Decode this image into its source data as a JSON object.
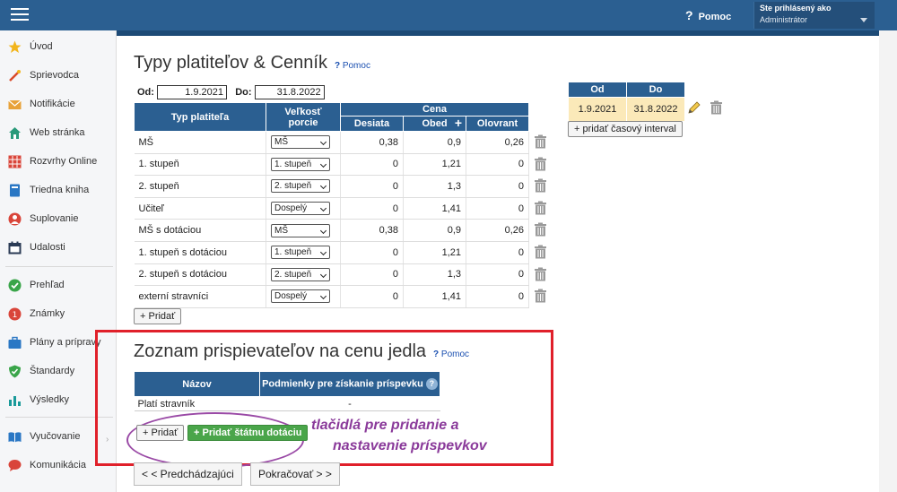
{
  "topbar": {
    "help_label": "Pomoc",
    "user_label": "Ste prihlásený ako",
    "user_value": "Administrátor"
  },
  "sidebar": {
    "items": [
      {
        "label": "Úvod",
        "icon": "star-icon",
        "color": "#f2b51c"
      },
      {
        "label": "Sprievodca",
        "icon": "wand-icon",
        "color": "#d94b2b"
      },
      {
        "label": "Notifikácie",
        "icon": "envelope-icon",
        "color": "#e8a23a"
      },
      {
        "label": "Web stránka",
        "icon": "home-icon",
        "color": "#2a9a7a"
      },
      {
        "label": "Rozvrhy Online",
        "icon": "calendar-grid-icon",
        "color": "#d9453a"
      },
      {
        "label": "Triedna kniha",
        "icon": "book-icon",
        "color": "#2a77c4"
      },
      {
        "label": "Suplovanie",
        "icon": "person-icon",
        "color": "#d9453a"
      },
      {
        "label": "Udalosti",
        "icon": "calendar-icon",
        "color": "#2b3b55"
      },
      {
        "label": "Prehľad",
        "icon": "check-circle-icon",
        "color": "#3aa54a"
      },
      {
        "label": "Známky",
        "icon": "grade-icon",
        "color": "#d9453a"
      },
      {
        "label": "Plány a prípravy",
        "icon": "briefcase-icon",
        "color": "#2a77c4"
      },
      {
        "label": "Štandardy",
        "icon": "shield-check-icon",
        "color": "#3aa54a"
      },
      {
        "label": "Výsledky",
        "icon": "bar-chart-icon",
        "color": "#1a9a9a"
      },
      {
        "label": "Vyučovanie",
        "icon": "open-book-icon",
        "color": "#2a77c4"
      },
      {
        "label": "Komunikácia",
        "icon": "chat-icon",
        "color": "#d9453a"
      }
    ]
  },
  "main": {
    "title": "Typy platiteľov & Cenník",
    "help_label": "Pomoc",
    "date_from_label": "Od:",
    "date_from": "1.9.2021",
    "date_to_label": "Do:",
    "date_to": "31.8.2022",
    "table": {
      "col_type": "Typ platiteľa",
      "col_size": "Veľkosť porcie",
      "col_price": "Cena",
      "col_snack1": "Desiata",
      "col_lunch": "Obed",
      "col_snack2": "Olovrant",
      "rows": [
        {
          "type": "MŠ",
          "size": "MŠ",
          "desiata": "0,38",
          "obed": "0,9",
          "olovrant": "0,26"
        },
        {
          "type": "1. stupeň",
          "size": "1. stupeň",
          "desiata": "0",
          "obed": "1,21",
          "olovrant": "0"
        },
        {
          "type": "2. stupeň",
          "size": "2. stupeň",
          "desiata": "0",
          "obed": "1,3",
          "olovrant": "0"
        },
        {
          "type": "Učiteľ",
          "size": "Dospelý",
          "desiata": "0",
          "obed": "1,41",
          "olovrant": "0"
        },
        {
          "type": "MŠ s dotáciou",
          "size": "MŠ",
          "desiata": "0,38",
          "obed": "0,9",
          "olovrant": "0,26"
        },
        {
          "type": "1. stupeň s dotáciou",
          "size": "1. stupeň",
          "desiata": "0",
          "obed": "1,21",
          "olovrant": "0"
        },
        {
          "type": "2. stupeň s dotáciou",
          "size": "2. stupeň",
          "desiata": "0",
          "obed": "1,3",
          "olovrant": "0"
        },
        {
          "type": "externí stravníci",
          "size": "Dospelý",
          "desiata": "0",
          "obed": "1,41",
          "olovrant": "0"
        }
      ]
    },
    "add_label": "+ Pridať",
    "interval": {
      "col_from": "Od",
      "col_to": "Do",
      "from": "1.9.2021",
      "to": "31.8.2022",
      "add_label": "+ pridať časový interval"
    }
  },
  "contrib": {
    "title": "Zoznam prispievateľov na cenu jedla",
    "help_label": "Pomoc",
    "col_name": "Názov",
    "col_cond": "Podmienky pre získanie príspevku",
    "rows": [
      {
        "name": "Platí stravník",
        "cond": "-"
      }
    ],
    "add_label": "+ Pridať",
    "add_state_label": "+ Pridať štátnu dotáciu",
    "annotation_line1": "tlačidlá pre pridanie a",
    "annotation_line2": "nastavenie príspevkov"
  },
  "nav": {
    "prev_label": "< < Predchádzajúci",
    "next_label": "Pokračovať > >"
  },
  "colors": {
    "header": "#2b5f91",
    "highlight": "#e0202a",
    "annotation": "#8a3a9a",
    "interval_bg": "#fbe9b9",
    "add_state_btn": "#4aa54a"
  }
}
